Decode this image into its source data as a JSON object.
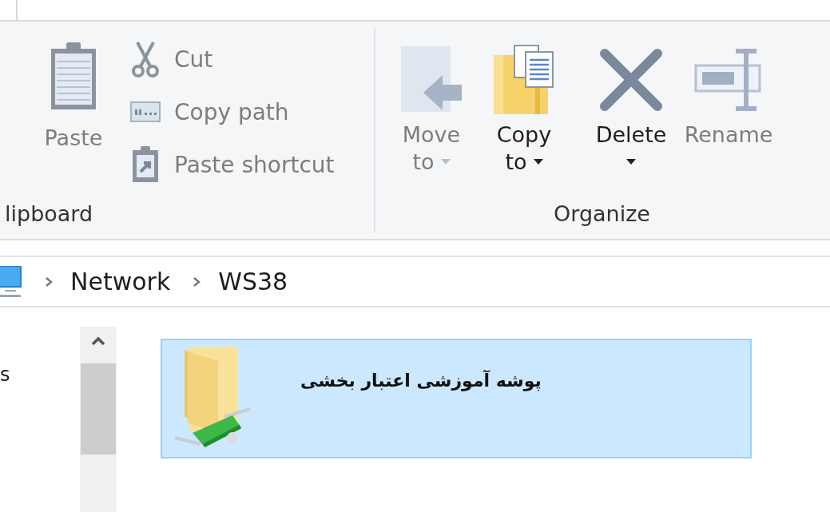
{
  "ribbon": {
    "clipboard": {
      "label": "lipboard",
      "paste": {
        "label": "Paste",
        "disabled": true
      },
      "small_buttons": [
        {
          "kind": "cut",
          "label": "Cut",
          "disabled": true
        },
        {
          "kind": "copy-path",
          "label": "Copy path",
          "disabled": true
        },
        {
          "kind": "paste-shortcut",
          "label": "Paste shortcut",
          "disabled": true
        }
      ]
    },
    "organize": {
      "label": "Organize",
      "buttons": [
        {
          "kind": "move",
          "label": "Move",
          "label_2": "to",
          "dropdown": true,
          "disabled": true
        },
        {
          "kind": "copy",
          "label": "Copy",
          "label_2": "to",
          "dropdown": true,
          "disabled": false
        },
        {
          "kind": "delete",
          "label": "Delete",
          "dropdown": true,
          "disabled": false
        },
        {
          "kind": "rename",
          "label": "Rename",
          "dropdown": false,
          "disabled": true
        }
      ]
    }
  },
  "breadcrumb": [
    "Network",
    "WS38"
  ],
  "nav_pane": {
    "text": "s"
  },
  "items": [
    {
      "name": "پوشه آموزشی اعتبار بخشی",
      "selected": true
    }
  ]
}
